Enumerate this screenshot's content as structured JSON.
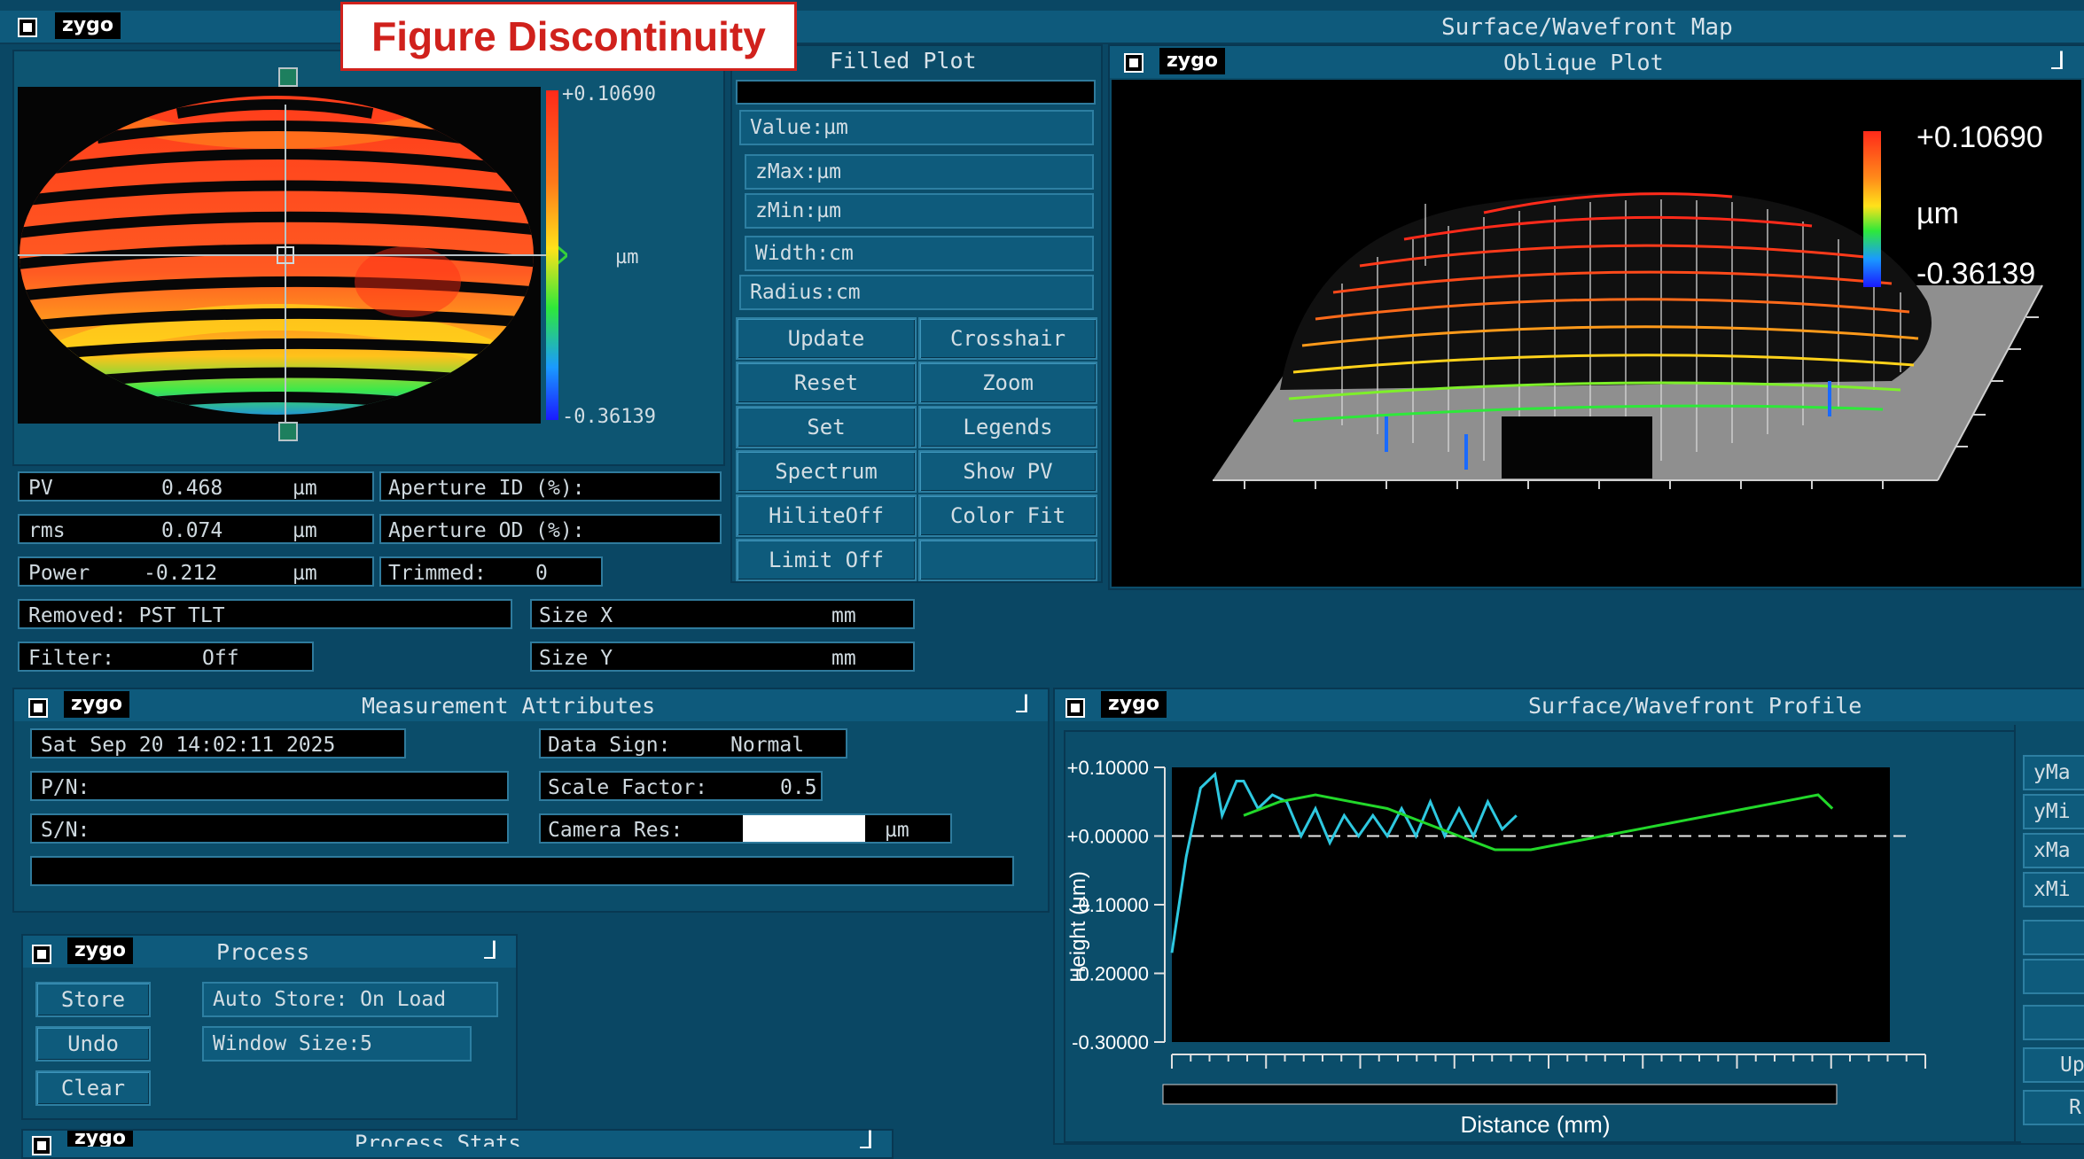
{
  "annotation": {
    "label": "Figure Discontinuity"
  },
  "main_window": {
    "title": "Surface/Wavefront Map"
  },
  "filled_plot": {
    "title": "Filled Plot",
    "scale_max": "+0.10690",
    "scale_unit": "µm",
    "scale_min": "-0.36139",
    "fields": [
      {
        "label": "Value:",
        "unit": "µm"
      },
      {
        "label": "zMax:",
        "unit": "µm"
      },
      {
        "label": "zMin:",
        "unit": "µm"
      },
      {
        "label": "Width:",
        "unit": "cm"
      },
      {
        "label": "Radius:",
        "unit": "cm"
      }
    ],
    "buttons_left": [
      "Update",
      "Reset",
      "Set",
      "Spectrum",
      "HiliteOff",
      "Limit Off"
    ],
    "buttons_right": [
      "Crosshair",
      "Zoom",
      "Legends",
      "Show PV",
      "Color Fit",
      ""
    ]
  },
  "oblique_plot": {
    "logo": "zygo",
    "title": "Oblique Plot",
    "scale_max": "+0.10690",
    "scale_unit": "µm",
    "scale_min": "-0.36139",
    "colors": {
      "high": "#ff2a1a",
      "mid": "#ffd21a",
      "low": "#1a35ff",
      "base": "#8f8f8f"
    }
  },
  "results": {
    "pv": {
      "label": "PV",
      "value": "0.468",
      "unit": "µm"
    },
    "rms": {
      "label": "rms",
      "value": "0.074",
      "unit": "µm"
    },
    "power": {
      "label": "Power",
      "value": "-0.212",
      "unit": "µm"
    },
    "aperture_id": "Aperture ID (%):",
    "aperture_od": "Aperture OD (%):",
    "trimmed": {
      "label": "Trimmed:",
      "value": "0"
    },
    "removed": "Removed: PST TLT",
    "filter": {
      "label": "Filter:",
      "value": "Off"
    },
    "size_x": {
      "label": "Size X",
      "unit": "mm"
    },
    "size_y": {
      "label": "Size Y",
      "unit": "mm"
    }
  },
  "measurement": {
    "logo": "zygo",
    "title": "Measurement Attributes",
    "date": "Sat Sep 20 14:02:11 2025",
    "pn": "P/N:",
    "sn": "S/N:",
    "data_sign": {
      "label": "Data Sign:",
      "value": "Normal"
    },
    "scale_factor": {
      "label": "Scale Factor:",
      "value": "0.5"
    },
    "camera_res": {
      "label": "Camera Res:",
      "unit": "µm"
    }
  },
  "process": {
    "logo": "zygo",
    "title": "Process",
    "store": "Store",
    "undo": "Undo",
    "clear": "Clear",
    "auto_store": "Auto Store: On Load",
    "window_size": {
      "label": "Window Size:",
      "value": "5"
    }
  },
  "process_stats": {
    "logo": "zygo",
    "title": "Process Stats"
  },
  "profile": {
    "logo": "zygo",
    "title": "Surface/Wavefront Profile",
    "side_buttons": [
      "yMa",
      "yMi",
      "xMa",
      "xMi",
      "",
      "",
      "",
      "Up",
      "R"
    ]
  },
  "chart_data": {
    "type": "line",
    "xlabel": "Distance (mm)",
    "ylabel": "Height (µm)",
    "ylim": [
      -0.3,
      0.1
    ],
    "yticks": [
      "+0.10000",
      "+0.00000",
      "-0.10000",
      "-0.20000",
      "-0.30000"
    ],
    "reference_line": 0,
    "grid": false,
    "series": [
      {
        "color": "#2ec8e0",
        "points": [
          [
            0.0,
            -0.17
          ],
          [
            0.02,
            -0.03
          ],
          [
            0.04,
            0.07
          ],
          [
            0.06,
            0.09
          ],
          [
            0.07,
            0.03
          ],
          [
            0.09,
            0.08
          ],
          [
            0.1,
            0.08
          ],
          [
            0.12,
            0.04
          ],
          [
            0.14,
            0.06
          ],
          [
            0.16,
            0.05
          ],
          [
            0.18,
            0.0
          ],
          [
            0.2,
            0.04
          ],
          [
            0.22,
            -0.01
          ],
          [
            0.24,
            0.03
          ],
          [
            0.26,
            0.0
          ],
          [
            0.28,
            0.03
          ],
          [
            0.3,
            0.0
          ],
          [
            0.32,
            0.04
          ],
          [
            0.34,
            0.0
          ],
          [
            0.36,
            0.05
          ],
          [
            0.38,
            0.0
          ],
          [
            0.4,
            0.04
          ],
          [
            0.42,
            0.0
          ],
          [
            0.44,
            0.05
          ],
          [
            0.46,
            0.01
          ],
          [
            0.48,
            0.03
          ]
        ]
      },
      {
        "color": "#22d82a",
        "points": [
          [
            0.1,
            0.03
          ],
          [
            0.15,
            0.05
          ],
          [
            0.2,
            0.06
          ],
          [
            0.25,
            0.05
          ],
          [
            0.3,
            0.04
          ],
          [
            0.35,
            0.02
          ],
          [
            0.4,
            0.0
          ],
          [
            0.45,
            -0.02
          ],
          [
            0.5,
            -0.02
          ],
          [
            0.55,
            -0.01
          ],
          [
            0.6,
            0.0
          ],
          [
            0.65,
            0.01
          ],
          [
            0.7,
            0.02
          ],
          [
            0.75,
            0.03
          ],
          [
            0.8,
            0.04
          ],
          [
            0.85,
            0.05
          ],
          [
            0.9,
            0.06
          ],
          [
            0.92,
            0.04
          ]
        ]
      }
    ]
  }
}
